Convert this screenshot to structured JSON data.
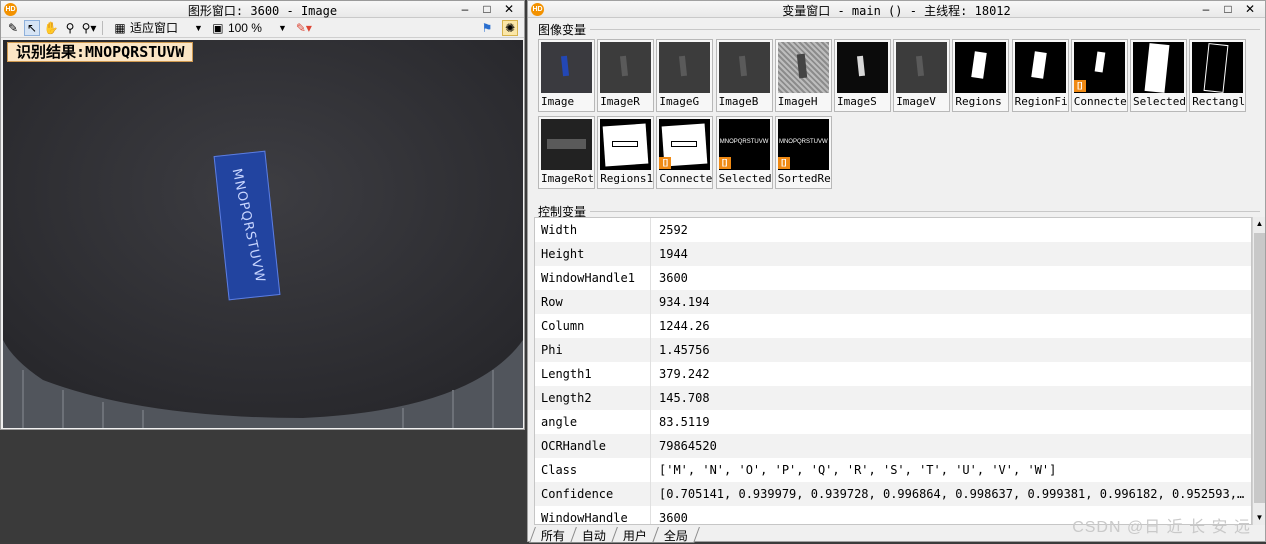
{
  "graphics_window": {
    "title": "图形窗口: 3600 - Image",
    "buttons": [
      "–",
      "□",
      "✕"
    ],
    "zoom_mode": "适应窗口",
    "zoom_percent": "100 %",
    "ocr_result": "识别结果:MNOPQRSTUVW",
    "plate_text": "MNOPQRSTUVW"
  },
  "variable_window": {
    "title": "变量窗口 - main () - 主线程: 18012",
    "buttons": [
      "–",
      "□",
      "✕"
    ],
    "image_section_label": "图像变量",
    "control_section_label": "控制变量",
    "image_vars": [
      {
        "name": "Image",
        "style": "color",
        "tag": false
      },
      {
        "name": "ImageR",
        "style": "gray",
        "tag": false
      },
      {
        "name": "ImageG",
        "style": "gray",
        "tag": false
      },
      {
        "name": "ImageB",
        "style": "gray",
        "tag": false
      },
      {
        "name": "ImageH",
        "style": "noise",
        "tag": false
      },
      {
        "name": "ImageS",
        "style": "dark",
        "tag": false
      },
      {
        "name": "ImageV",
        "style": "gray",
        "tag": false
      },
      {
        "name": "Regions",
        "style": "region",
        "tag": false
      },
      {
        "name": "RegionFi",
        "style": "region",
        "tag": false
      },
      {
        "name": "Connecte",
        "style": "regionsmall",
        "tag": true
      },
      {
        "name": "Selected",
        "style": "bigregion",
        "tag": false
      },
      {
        "name": "Rectangl",
        "style": "rect",
        "tag": false
      },
      {
        "name": "ImageRot",
        "style": "rot",
        "tag": false
      },
      {
        "name": "Regions1",
        "style": "whitebox",
        "tag": false
      },
      {
        "name": "Connecte",
        "style": "whitebox",
        "tag": true
      },
      {
        "name": "Selected",
        "style": "textimg",
        "tag": true
      },
      {
        "name": "SortedRe",
        "style": "textimg",
        "tag": true
      }
    ],
    "thumb_text": "MNOPQRSTUVW",
    "control_vars": [
      {
        "name": "Width",
        "value": "2592"
      },
      {
        "name": "Height",
        "value": "1944"
      },
      {
        "name": "WindowHandle1",
        "value": "3600"
      },
      {
        "name": "Row",
        "value": "934.194"
      },
      {
        "name": "Column",
        "value": "1244.26"
      },
      {
        "name": "Phi",
        "value": "1.45756"
      },
      {
        "name": "Length1",
        "value": "379.242"
      },
      {
        "name": "Length2",
        "value": "145.708"
      },
      {
        "name": "angle",
        "value": "83.5119"
      },
      {
        "name": "OCRHandle",
        "value": "79864520"
      },
      {
        "name": "Class",
        "value": "['M', 'N', 'O', 'P', 'Q', 'R', 'S', 'T', 'U', 'V', 'W']"
      },
      {
        "name": "Confidence",
        "value": "[0.705141, 0.939979, 0.939728, 0.996864, 0.998637, 0.999381, 0.996182, 0.952593,…"
      },
      {
        "name": "WindowHandle",
        "value": "3600"
      }
    ],
    "tabs": [
      "所有",
      "自动",
      "用户",
      "全局"
    ]
  },
  "watermark": "CSDN @日 近 长 安 远"
}
